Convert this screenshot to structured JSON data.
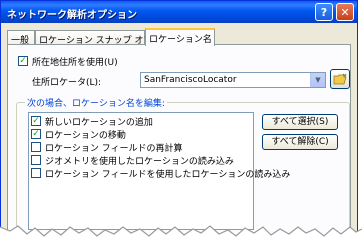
{
  "window": {
    "title": "ネットワーク解析オプション",
    "help_label": "?",
    "close_label": "✕"
  },
  "tabs": [
    {
      "label": "一般",
      "active": false
    },
    {
      "label": "ロケーション スナップ オプション",
      "active": false
    },
    {
      "label": "ロケーション名",
      "active": true
    }
  ],
  "use_locator": {
    "checked": true,
    "label": "所在地住所を使用(U)"
  },
  "locator": {
    "label": "住所ロケータ(L):",
    "value": "SanFranciscoLocator",
    "browse_icon": "folder-open-icon"
  },
  "rename_group": {
    "title": "次の場合、ロケーション名を編集:",
    "items": [
      {
        "label": "新しいロケーションの追加",
        "checked": true
      },
      {
        "label": "ロケーションの移動",
        "checked": true
      },
      {
        "label": "ロケーション フィールドの再計算",
        "checked": false
      },
      {
        "label": "ジオメトリを使用したロケーションの読み込み",
        "checked": false
      },
      {
        "label": "ロケーション フィールドを使用したロケーションの読み込み",
        "checked": false
      }
    ],
    "select_all_label": "すべて選択(S)",
    "clear_all_label": "すべて解除(C)"
  }
}
